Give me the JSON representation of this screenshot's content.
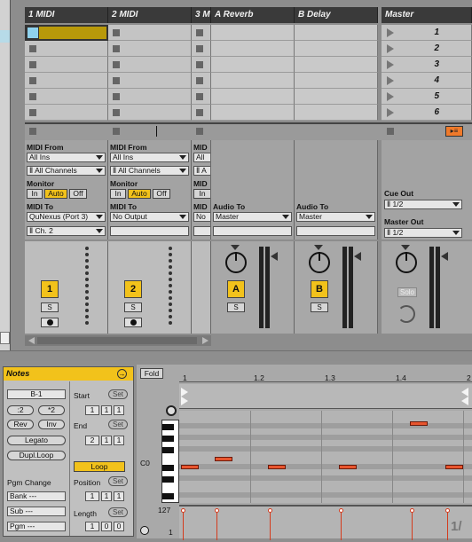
{
  "session": {
    "tracks": [
      {
        "name": "1 MIDI",
        "number": "1"
      },
      {
        "name": "2 MIDI",
        "number": "2"
      },
      {
        "name": "3 M"
      },
      {
        "name": "A Reverb",
        "letter": "A"
      },
      {
        "name": "B Delay",
        "letter": "B"
      },
      {
        "name": "Master"
      }
    ],
    "scenes": [
      "1",
      "2",
      "3",
      "4",
      "5",
      "6"
    ],
    "io": {
      "midi_from_label": "MIDI From",
      "midi_to_label": "MIDI To",
      "monitor_label": "Monitor",
      "audio_to_label": "Audio To",
      "cue_out_label": "Cue Out",
      "master_out_label": "Master Out",
      "mid_fragment": "MID",
      "track1": {
        "from": "All Ins",
        "channel": "Ⅱ All Channels",
        "to": "QuNexus (Port 3)",
        "to_channel": "Ⅱ Ch. 2"
      },
      "track2": {
        "from": "All Ins",
        "channel": "Ⅱ All Channels",
        "to": "No Output"
      },
      "track3": {
        "from": "All",
        "channel": "Ⅱ A",
        "to": "No",
        "monitor_fragment": "In"
      },
      "reverb_to": "Master",
      "delay_to": "Master",
      "cue_out": "Ⅱ 1/2",
      "master_out": "Ⅱ 1/2",
      "monitor_in": "In",
      "monitor_auto": "Auto",
      "monitor_off": "Off"
    },
    "mixer": {
      "solo_label": "S",
      "master_solo": "Solo"
    }
  },
  "clip": {
    "notes_title": "Notes",
    "pitch": "B-1",
    "half": ":2",
    "double": "*2",
    "rev": "Rev",
    "inv": "Inv",
    "legato": "Legato",
    "dupl_loop": "Dupl.Loop",
    "pgm_change": "Pgm Change",
    "bank": "Bank ---",
    "sub": "Sub ---",
    "pgm": "Pgm ---",
    "start_label": "Start",
    "end_label": "End",
    "position_label": "Position",
    "length_label": "Length",
    "set_label": "Set",
    "loop_label": "Loop",
    "start": [
      "1",
      "1",
      "1"
    ],
    "end": [
      "2",
      "1",
      "1"
    ],
    "position": [
      "1",
      "1",
      "1"
    ],
    "length": [
      "1",
      "0",
      "0"
    ]
  },
  "editor": {
    "fold": "Fold",
    "ruler": [
      "1",
      "1.2",
      "1.3",
      "1.4",
      "2"
    ],
    "c0_label": "C0",
    "velocity_max": "127",
    "velocity_min": "1",
    "page_fragment": "1/"
  }
}
